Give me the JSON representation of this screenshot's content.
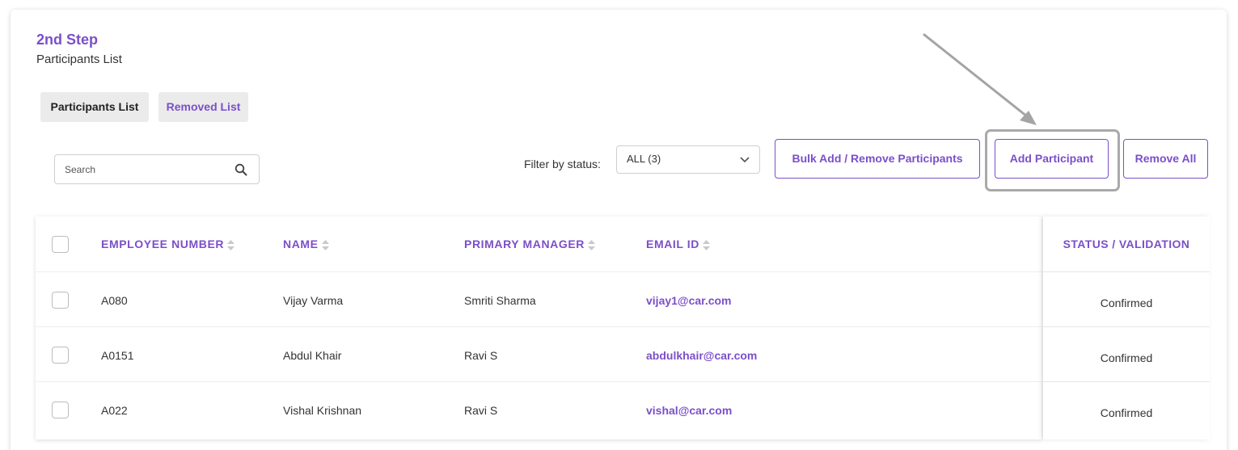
{
  "step": {
    "title": "2nd Step",
    "subtitle": "Participants List"
  },
  "tabs": [
    {
      "label": "Participants List",
      "active": true
    },
    {
      "label": "Removed List",
      "active": false
    }
  ],
  "search": {
    "placeholder": "Search",
    "value": ""
  },
  "filter": {
    "label": "Filter by status:",
    "selected": "ALL (3)"
  },
  "buttons": {
    "bulk": "Bulk Add / Remove Participants",
    "add": "Add Participant",
    "remove_all": "Remove All"
  },
  "table": {
    "columns": {
      "employee_number": "EMPLOYEE NUMBER",
      "name": "NAME",
      "primary_manager": "PRIMARY MANAGER",
      "email": "EMAIL ID",
      "status": "STATUS / VALIDATION"
    },
    "rows": [
      {
        "employee_number": "A080",
        "name": "Vijay Varma",
        "primary_manager": "Smriti Sharma",
        "email": "vijay1@car.com",
        "status": "Confirmed"
      },
      {
        "employee_number": "A0151",
        "name": "Abdul Khair",
        "primary_manager": "Ravi S",
        "email": "abdulkhair@car.com",
        "status": "Confirmed"
      },
      {
        "employee_number": "A022",
        "name": "Vishal Krishnan",
        "primary_manager": "Ravi S",
        "email": "vishal@car.com",
        "status": "Confirmed"
      }
    ]
  },
  "colors": {
    "accent": "#7b4fc9",
    "tab_bg": "#ebebeb",
    "highlight": "#a9a9a9"
  },
  "icons": {
    "search": "search-icon",
    "dropdown": "chevron-down-icon",
    "sort": "sort-icon",
    "annotation": "arrow-annotation"
  }
}
